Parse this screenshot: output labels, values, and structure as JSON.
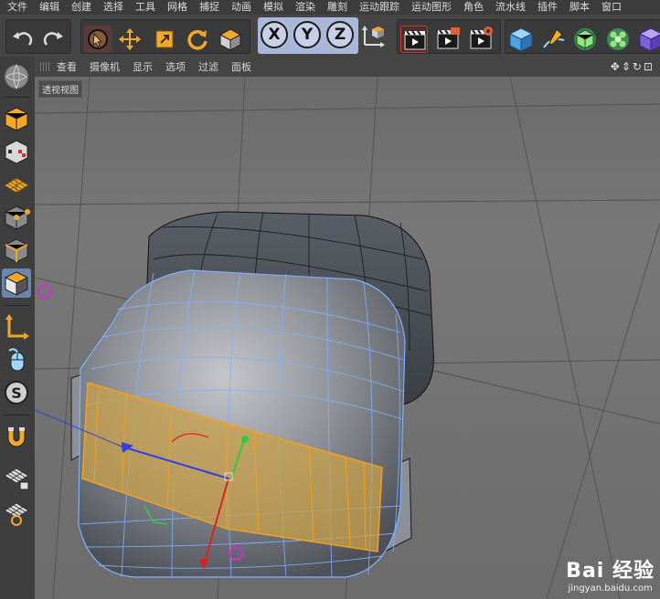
{
  "menu": [
    "文件",
    "编辑",
    "创建",
    "选择",
    "工具",
    "网格",
    "捕捉",
    "动画",
    "模拟",
    "渲染",
    "雕刻",
    "运动跟踪",
    "运动图形",
    "角色",
    "流水线",
    "插件",
    "脚本",
    "窗口"
  ],
  "toolbar": {
    "undo": "undo-icon",
    "redo": "redo-icon",
    "axis_x": "X",
    "axis_y": "Y",
    "axis_z": "Z"
  },
  "viewport_menu": [
    "查看",
    "摄像机",
    "显示",
    "选项",
    "过滤",
    "面板"
  ],
  "viewport_nav_icons": "✥⇕↻⊡",
  "viewport_label": "透视视图",
  "watermark": {
    "brand": "Bai 经验",
    "url": "jingyan.baidu.com"
  },
  "colors": {
    "selection_orange": "#f0a020",
    "wire_blue": "#7fb0ff",
    "accent_magenta": "#d030d0"
  }
}
